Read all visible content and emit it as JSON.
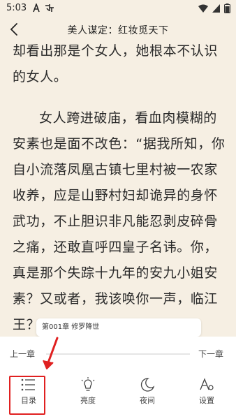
{
  "status_bar": {
    "time": "5:03",
    "left_icons": [
      "a-icon",
      "sim-icon"
    ],
    "right_icons": [
      "wifi-icon",
      "signal-icon",
      "battery-icon"
    ]
  },
  "header": {
    "title": "美人谋定：红妆觅天下",
    "back_icon": "back-arrow-icon"
  },
  "content": {
    "paragraph1": "却看出那是个女人，她根本不认识的女人。",
    "paragraph2": "女人跨进破庙，看血肉模糊的安素也是面不改色：“据我所知，你自小流落凤凰古镇七里村被一农家收养，应是山野村妇却诡异的身怀武功，不止胆识非凡能忍剥皮碎骨之痛，还敢直呼四皇子名讳。你，真是那个失踪十九年的安九小姐安素？又或者，我该唤你一声，临江王？”"
  },
  "chapter_tip": "第001章 修罗降世",
  "navigation": {
    "prev_label": "上一章",
    "next_label": "下一章",
    "progress": 0.0
  },
  "toolbar": {
    "items": [
      {
        "label": "目录",
        "icon": "list-icon"
      },
      {
        "label": "亮度",
        "icon": "lightbulb-icon"
      },
      {
        "label": "夜间",
        "icon": "moon-icon"
      },
      {
        "label": "设置",
        "icon": "font-settings-icon"
      }
    ]
  },
  "colors": {
    "page_background": "#f6efe3",
    "panel_background": "#ffffff",
    "highlight": "#e02020"
  }
}
